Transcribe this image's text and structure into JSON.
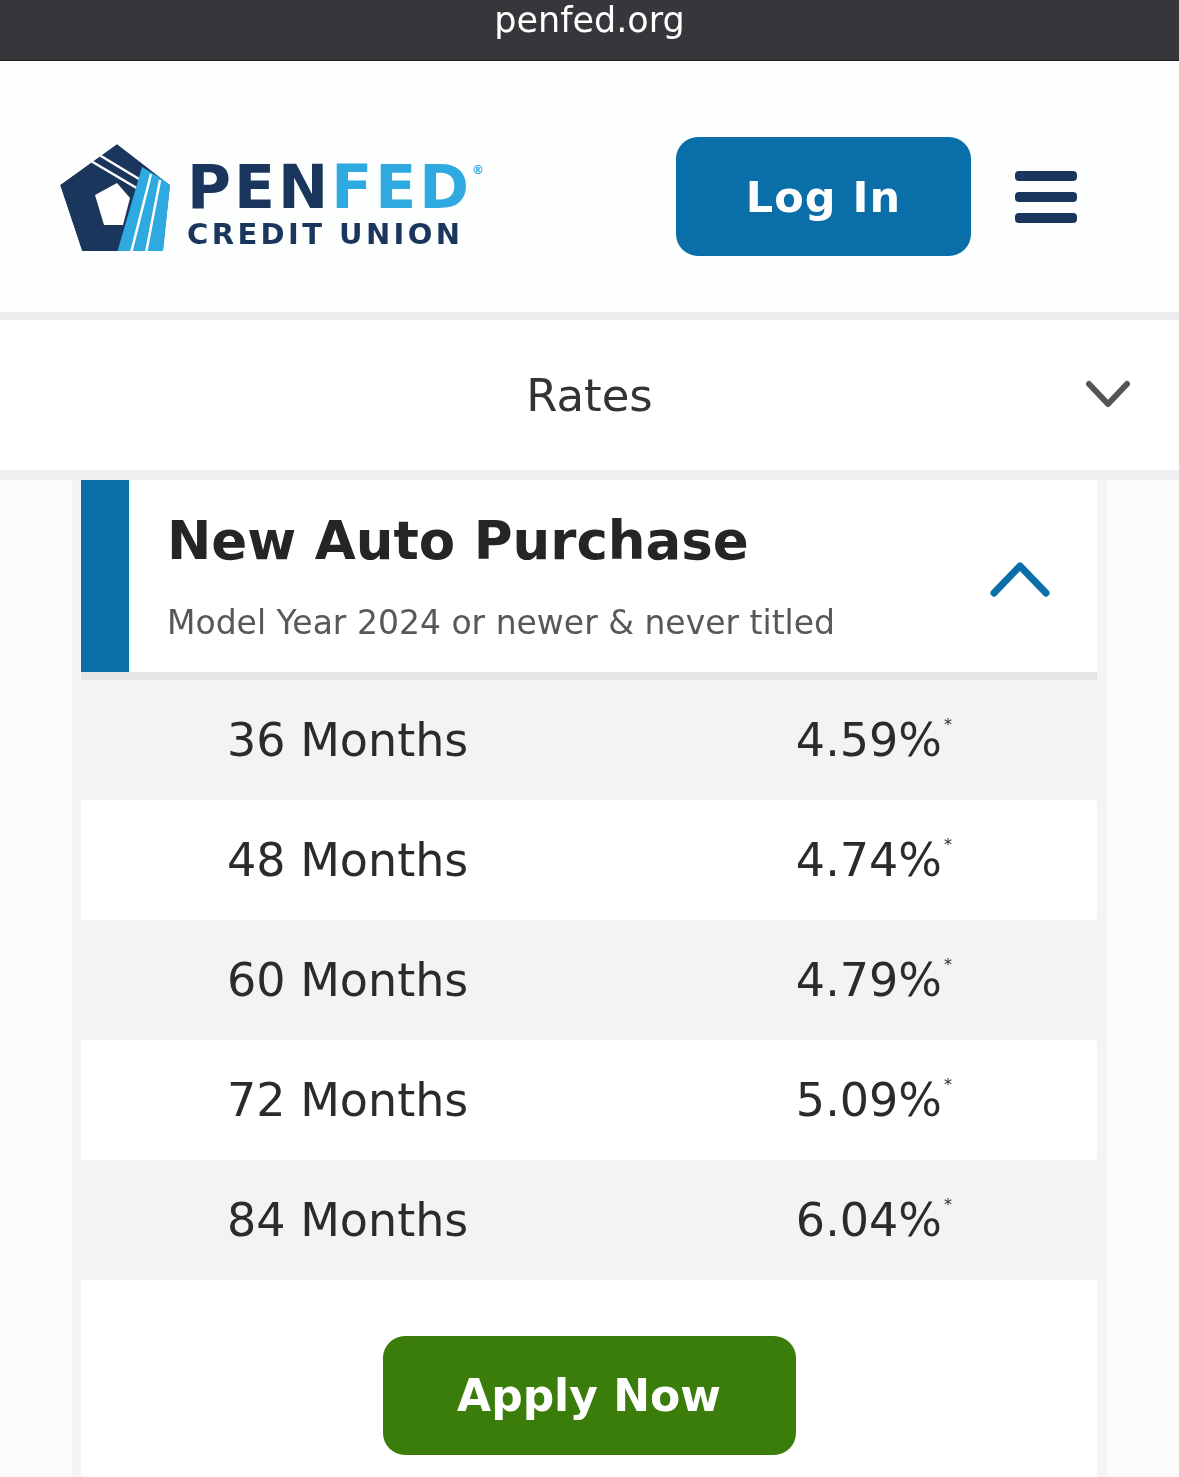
{
  "browser_bar": {
    "domain": "penfed.org"
  },
  "header": {
    "logo": {
      "wordmark": [
        {
          "text": "PEN",
          "color": "#1b365d"
        },
        {
          "text": "FED$^{®}$",
          "color": "#2eaae1"
        }
      ],
      "tagline": "CREDIT UNION"
    },
    "login_button": "Log In"
  },
  "rates_dropdown": {
    "label": "Rates",
    "expanded": false
  },
  "rate_panel": {
    "title": "New Auto Purchase",
    "subtitle": "Model Year 2024 or newer & never titled",
    "expanded": true,
    "rows": [
      {
        "term": "36 Months",
        "rate": "4.59%$^{*}$"
      },
      {
        "term": "48 Months",
        "rate": "4.74%$^{*}$"
      },
      {
        "term": "60 Months",
        "rate": "4.79%$^{*}$"
      },
      {
        "term": "72 Months",
        "rate": "5.09%$^{*}$"
      },
      {
        "term": "84 Months",
        "rate": "6.04%$^{*}$"
      }
    ],
    "apply_button": "Apply Now"
  }
}
